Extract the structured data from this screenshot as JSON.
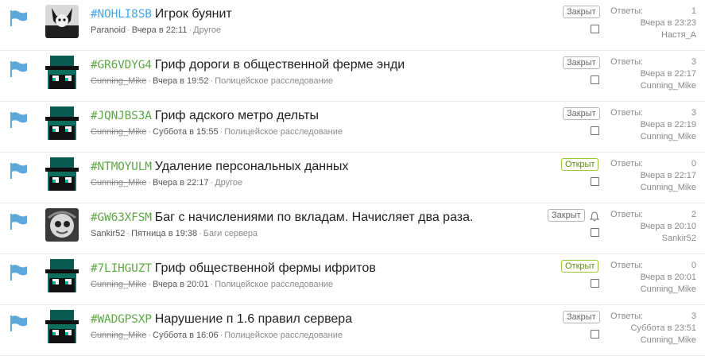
{
  "threads": [
    {
      "id": "#NOHLI8SB",
      "id_color": "blue",
      "title": "Игрок буянит",
      "author": "Paranoid",
      "author_struck": false,
      "date": "Вчера в 22:11",
      "category": "Другое",
      "status": "Закрыт",
      "status_type": "closed",
      "replies_label": "Ответы:",
      "replies": "1",
      "last_date": "Вчера в 23:23",
      "last_user": "Настя_А",
      "avatar": "avatar-bw",
      "bell": false
    },
    {
      "id": "#GR6VDYG4",
      "id_color": "green",
      "title": "Гриф дороги в общественной ферме энди",
      "author": "Cunning_Mike",
      "author_struck": true,
      "date": "Вчера в 19:52",
      "category": "Полицейское расследование",
      "status": "Закрыт",
      "status_type": "closed",
      "replies_label": "Ответы:",
      "replies": "3",
      "last_date": "Вчера в 22:17",
      "last_user": "Cunning_Mike",
      "avatar": "avatar-pixel",
      "bell": false
    },
    {
      "id": "#JQNJBS3A",
      "id_color": "green",
      "title": "Гриф адского метро дельты",
      "author": "Cunning_Mike",
      "author_struck": true,
      "date": "Суббота в 15:55",
      "category": "Полицейское расследование",
      "status": "Закрыт",
      "status_type": "closed",
      "replies_label": "Ответы:",
      "replies": "3",
      "last_date": "Вчера в 22:19",
      "last_user": "Cunning_Mike",
      "avatar": "avatar-pixel",
      "bell": false
    },
    {
      "id": "#NTMOYULM",
      "id_color": "green",
      "title": "Удаление персональных данных",
      "author": "Cunning_Mike",
      "author_struck": true,
      "date": "Вчера в 22:17",
      "category": "Другое",
      "status": "Открыт",
      "status_type": "open",
      "replies_label": "Ответы:",
      "replies": "0",
      "last_date": "Вчера в 22:17",
      "last_user": "Cunning_Mike",
      "avatar": "avatar-pixel",
      "bell": false
    },
    {
      "id": "#GW63XFSM",
      "id_color": "green",
      "title": "Баг с начислениями по вкладам. Начисляет два раза.",
      "author": "Sankir52",
      "author_struck": false,
      "date": "Пятница в 19:38",
      "category": "Баги сервера",
      "status": "Закрыт",
      "status_type": "closed",
      "replies_label": "Ответы:",
      "replies": "2",
      "last_date": "Вчера в 20:10",
      "last_user": "Sankir52",
      "avatar": "avatar-gray",
      "bell": true
    },
    {
      "id": "#7LIHGUZT",
      "id_color": "green",
      "title": "Гриф общественной фермы ифритов",
      "author": "Cunning_Mike",
      "author_struck": true,
      "date": "Вчера в 20:01",
      "category": "Полицейское расследование",
      "status": "Открыт",
      "status_type": "open",
      "replies_label": "Ответы:",
      "replies": "0",
      "last_date": "Вчера в 20:01",
      "last_user": "Cunning_Mike",
      "avatar": "avatar-pixel",
      "bell": false
    },
    {
      "id": "#WADGPSXP",
      "id_color": "green",
      "title": "Нарушение п 1.6 правил сервера",
      "author": "Cunning_Mike",
      "author_struck": true,
      "date": "Суббота в 16:06",
      "category": "Полицейское расследование",
      "status": "Закрыт",
      "status_type": "closed",
      "replies_label": "Ответы:",
      "replies": "3",
      "last_date": "Суббота в 23:51",
      "last_user": "Cunning_Mike",
      "avatar": "avatar-pixel",
      "bell": false
    }
  ],
  "colors": {
    "flag": "#5fa8dc",
    "id_blue": "#47a7eb",
    "id_green": "#5fa846",
    "open_border": "#9cc43a"
  }
}
